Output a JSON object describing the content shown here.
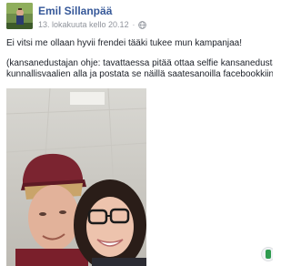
{
  "post": {
    "author": "Emil Sillanpää",
    "timestamp": "13. lokakuuta kello 20.12",
    "separator": "·",
    "privacy_icon": "globe-icon",
    "text_line1": "Ei vitsi me ollaan hyvii frendei tääki tukee mun kampanjaa!",
    "text_line2": "(kansanedustajan ohje: tavattaessa pitää ottaa selfie kansanedustaj",
    "text_line3": "kunnallisvaalien alla ja postata se näillä saatesanoilla facebookkiin)"
  },
  "colors": {
    "author_link": "#365899",
    "meta_gray": "#90949c",
    "body_text": "#1d2129"
  }
}
